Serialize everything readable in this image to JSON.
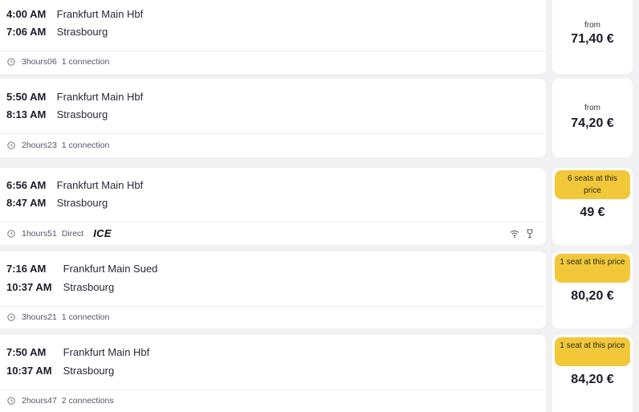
{
  "journeys": [
    {
      "dep_time": "4:00 AM",
      "dep_station": "Frankfurt Main Hbf",
      "arr_time": "7:06 AM",
      "arr_station": "Strasbourg",
      "duration": "3hours06",
      "connection": "1 connection",
      "from_label": "from",
      "price": "71,40 €"
    },
    {
      "dep_time": "5:50 AM",
      "dep_station": "Frankfurt Main Hbf",
      "arr_time": "8:13 AM",
      "arr_station": "Strasbourg",
      "duration": "2hours23",
      "connection": "1 connection",
      "from_label": "from",
      "price": "74,20 €"
    },
    {
      "dep_time": "6:56 AM",
      "dep_station": "Frankfurt Main Hbf",
      "arr_time": "8:47 AM",
      "arr_station": "Strasbourg",
      "duration": "1hours51",
      "connection": "Direct",
      "train_brand": "ICE",
      "amenities": [
        "wifi-icon",
        "bistro-glass-icon"
      ],
      "seats_badge": "6 seats at this price",
      "price": "49 €"
    },
    {
      "dep_time": "7:16 AM",
      "dep_station": "Frankfurt Main Sued",
      "arr_time": "10:37 AM",
      "arr_station": "Strasbourg",
      "duration": "3hours21",
      "connection": "1 connection",
      "seats_badge": "1 seat at this price",
      "price": "80,20 €"
    },
    {
      "dep_time": "7:50 AM",
      "dep_station": "Frankfurt Main Hbf",
      "arr_time": "10:37 AM",
      "arr_station": "Strasbourg",
      "duration": "2hours47",
      "connection": "2 connections",
      "seats_badge": "1 seat at this price",
      "price": "84,20 €"
    }
  ],
  "colors": {
    "page_background": "#f1f1f4",
    "card_background": "#ffffff",
    "badge_yellow": "#f2c83a",
    "text_dark": "#1c1c2b"
  }
}
